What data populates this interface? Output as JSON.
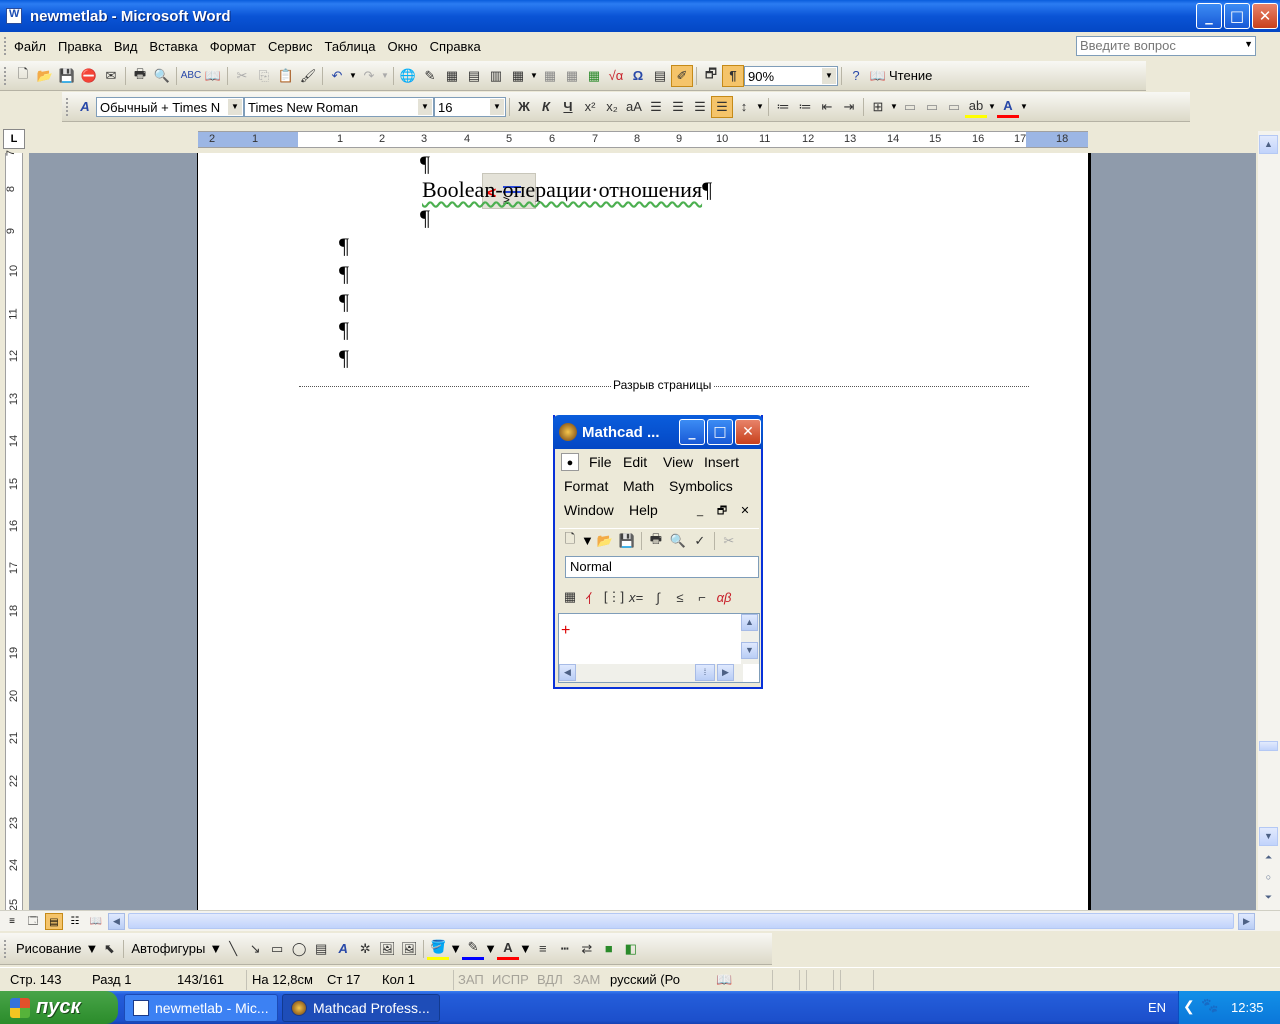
{
  "window": {
    "title": "newmetlab - Microsoft Word"
  },
  "menu": [
    "Файл",
    "Правка",
    "Вид",
    "Вставка",
    "Формат",
    "Сервис",
    "Таблица",
    "Окно",
    "Справка"
  ],
  "ask_placeholder": "Введите вопрос",
  "standard_toolbar": {
    "zoom": "90%",
    "reading_label": "Чтение"
  },
  "format_toolbar": {
    "style": "Обычный + Times N",
    "font": "Times New Roman",
    "size": "16"
  },
  "ruler_h": [
    "2",
    "1",
    "1",
    "2",
    "3",
    "4",
    "5",
    "6",
    "7",
    "8",
    "9",
    "10",
    "11",
    "12",
    "13",
    "14",
    "15",
    "16",
    "17",
    "18"
  ],
  "ruler_v": [
    "7",
    "8",
    "9",
    "10",
    "11",
    "12",
    "13",
    "14",
    "15",
    "16",
    "17",
    "18",
    "19",
    "20",
    "21",
    "22",
    "23",
    "24",
    "25"
  ],
  "document": {
    "pilcrow": "¶",
    "line_text_main": "Boolean-операции·отношения",
    "line_text_end": "¶",
    "page_break": "Разрыв страницы"
  },
  "mathcad": {
    "title": "Mathcad ...",
    "menu_row1": [
      "File",
      "Edit",
      "View",
      "Insert"
    ],
    "menu_row2": [
      "Format",
      "Math",
      "Symbolics"
    ],
    "menu_row3": [
      "Window",
      "Help"
    ],
    "style": "Normal"
  },
  "drawing_toolbar": {
    "draw_label": "Рисование",
    "autoshapes_label": "Автофигуры"
  },
  "status": {
    "page": "Стр. 143",
    "section": "Разд 1",
    "pages": "143/161",
    "at": "На 12,8см",
    "line": "Ст 17",
    "col": "Кол 1",
    "rec": "ЗАП",
    "trk": "ИСПР",
    "ext": "ВДЛ",
    "ovr": "ЗАМ",
    "lang": "русский (Ро"
  },
  "taskbar": {
    "start": "пуск",
    "tasks": [
      "newmetlab - Mic...",
      "Mathcad Profess..."
    ],
    "lang": "EN",
    "time": "12:35"
  }
}
